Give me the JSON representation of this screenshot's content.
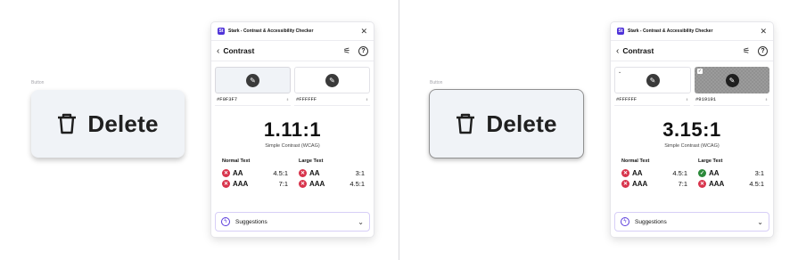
{
  "frame_label": "Button",
  "button": {
    "label": "Delete",
    "icon": "trash-icon"
  },
  "panel": {
    "app_title": "Stark - Contrast & Accessibility Checker",
    "app_logo_text": "St",
    "section_title": "Contrast",
    "suggestions_label": "Suggestions",
    "ratio_caption": "Simple Contrast (WCAG)",
    "normal_text_label": "Normal Text",
    "large_text_label": "Large Text"
  },
  "left": {
    "fg_hex": "#F0F3F7",
    "bg_hex": "#FFFFFF",
    "ratio": "1.11:1",
    "normal": [
      {
        "level": "AA",
        "req": "4.5:1",
        "status": "fail"
      },
      {
        "level": "AAA",
        "req": "7:1",
        "status": "fail"
      }
    ],
    "large": [
      {
        "level": "AA",
        "req": "3:1",
        "status": "fail"
      },
      {
        "level": "AAA",
        "req": "4.5:1",
        "status": "fail"
      }
    ]
  },
  "right": {
    "fg_hex": "#FFFFFF",
    "bg_hex": "#919191",
    "ratio": "3.15:1",
    "normal": [
      {
        "level": "AA",
        "req": "4.5:1",
        "status": "fail"
      },
      {
        "level": "AAA",
        "req": "7:1",
        "status": "fail"
      }
    ],
    "large": [
      {
        "level": "AA",
        "req": "3:1",
        "status": "pass"
      },
      {
        "level": "AAA",
        "req": "4.5:1",
        "status": "fail"
      }
    ]
  },
  "colors": {
    "button_bg": "#F0F3F7",
    "border": "#919191",
    "fail": "#D8344C",
    "pass": "#2C8A3B",
    "brand": "#4F33D9"
  }
}
